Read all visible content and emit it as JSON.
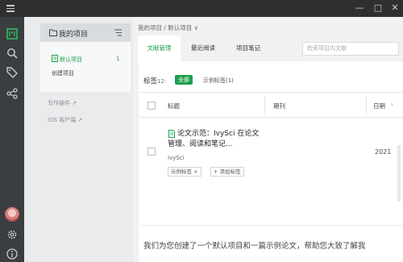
{
  "window": {
    "controls": [
      "—",
      "□",
      "✕"
    ]
  },
  "rail": {
    "icons": [
      "library-icon",
      "search-icon",
      "tag-icon",
      "share-icon",
      "avatar",
      "gear-icon",
      "info-icon"
    ]
  },
  "sidebar": {
    "header": "我的项目",
    "projects": [
      {
        "label": "默认项目",
        "count": "1"
      },
      {
        "label": "创建项目",
        "count": ""
      }
    ],
    "links": [
      "写作插件",
      "iOS 客户端"
    ]
  },
  "main": {
    "breadcrumb": "我的项目 / 默认项目 ∨",
    "tabs": [
      {
        "label": "文献管理",
        "active": true
      },
      {
        "label": "最近阅读",
        "active": false
      },
      {
        "label": "项目笔记",
        "active": false
      }
    ],
    "search_placeholder": "检索项目内文献",
    "tags_label": "标签",
    "tags_count": "12:",
    "tag_all": "全部",
    "tag_example": "示例标签(1)",
    "columns": {
      "title": "标题",
      "journal": "期刊",
      "date": "日期"
    },
    "rows": [
      {
        "title": "论文示范：IvySci 在论文管理、阅读和笔记...",
        "author": "IvySci",
        "tag": "示例标签 ×",
        "add_tag": "+ 添加标签",
        "year": "2021"
      }
    ],
    "hint": "我们为您创建了一个默认项目和一篇示例论文，帮助您大致了解我"
  },
  "colors": {
    "accent": "#1d9f4b",
    "titlebar": "#2d2f31",
    "rail": "#3b3e40",
    "sidebar": "#e9ebed"
  }
}
